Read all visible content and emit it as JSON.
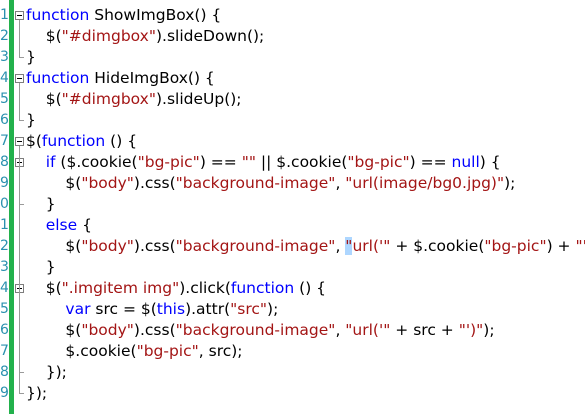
{
  "editor": {
    "line_numbers": [
      "1",
      "2",
      "3",
      "4",
      "5",
      "6",
      "7",
      "8",
      "9",
      "0",
      "1",
      "2",
      "3",
      "4",
      "5",
      "6",
      "7",
      "8",
      "9"
    ],
    "lines": [
      [
        {
          "t": "kw",
          "v": "function"
        },
        {
          "t": "pl",
          "v": " ShowImgBox() {"
        }
      ],
      [
        {
          "t": "pl",
          "v": "    $("
        },
        {
          "t": "str",
          "v": "\"#dimgbox\""
        },
        {
          "t": "pl",
          "v": ").slideDown();"
        }
      ],
      [
        {
          "t": "pl",
          "v": "}"
        }
      ],
      [
        {
          "t": "kw",
          "v": "function"
        },
        {
          "t": "pl",
          "v": " HideImgBox() {"
        }
      ],
      [
        {
          "t": "pl",
          "v": "    $("
        },
        {
          "t": "str",
          "v": "\"#dimgbox\""
        },
        {
          "t": "pl",
          "v": ").slideUp();"
        }
      ],
      [
        {
          "t": "pl",
          "v": "}"
        }
      ],
      [
        {
          "t": "pl",
          "v": "$("
        },
        {
          "t": "kw",
          "v": "function"
        },
        {
          "t": "pl",
          "v": " () {"
        }
      ],
      [
        {
          "t": "pl",
          "v": "    "
        },
        {
          "t": "kw",
          "v": "if"
        },
        {
          "t": "pl",
          "v": " ($.cookie("
        },
        {
          "t": "str",
          "v": "\"bg-pic\""
        },
        {
          "t": "pl",
          "v": ") == "
        },
        {
          "t": "str",
          "v": "\"\""
        },
        {
          "t": "pl",
          "v": " || $.cookie("
        },
        {
          "t": "str",
          "v": "\"bg-pic\""
        },
        {
          "t": "pl",
          "v": ") == "
        },
        {
          "t": "kw",
          "v": "null"
        },
        {
          "t": "pl",
          "v": ") {"
        }
      ],
      [
        {
          "t": "pl",
          "v": "        $("
        },
        {
          "t": "str",
          "v": "\"body\""
        },
        {
          "t": "pl",
          "v": ").css("
        },
        {
          "t": "str",
          "v": "\"background-image\""
        },
        {
          "t": "pl",
          "v": ", "
        },
        {
          "t": "str",
          "v": "\"url(image/bg0.jpg)\""
        },
        {
          "t": "pl",
          "v": ");"
        }
      ],
      [
        {
          "t": "pl",
          "v": "    }"
        }
      ],
      [
        {
          "t": "pl",
          "v": "    "
        },
        {
          "t": "kw",
          "v": "else"
        },
        {
          "t": "pl",
          "v": " {"
        }
      ],
      [
        {
          "t": "pl",
          "v": "        $("
        },
        {
          "t": "str",
          "v": "\"body\""
        },
        {
          "t": "pl",
          "v": ").css("
        },
        {
          "t": "str",
          "v": "\"background-image\""
        },
        {
          "t": "pl",
          "v": ", "
        },
        {
          "t": "sel",
          "v": "\""
        },
        {
          "t": "str",
          "v": "url('\""
        },
        {
          "t": "pl",
          "v": " + $.cookie("
        },
        {
          "t": "str",
          "v": "\"bg-pic\""
        },
        {
          "t": "pl",
          "v": ") + "
        },
        {
          "t": "str",
          "v": "\"')\""
        },
        {
          "t": "pl",
          "v": ");"
        }
      ],
      [
        {
          "t": "pl",
          "v": "    }"
        }
      ],
      [
        {
          "t": "pl",
          "v": "    $("
        },
        {
          "t": "str",
          "v": "\".imgitem img\""
        },
        {
          "t": "pl",
          "v": ").click("
        },
        {
          "t": "kw",
          "v": "function"
        },
        {
          "t": "pl",
          "v": " () {"
        }
      ],
      [
        {
          "t": "pl",
          "v": "        "
        },
        {
          "t": "kw",
          "v": "var"
        },
        {
          "t": "pl",
          "v": " src = $("
        },
        {
          "t": "kw",
          "v": "this"
        },
        {
          "t": "pl",
          "v": ").attr("
        },
        {
          "t": "str",
          "v": "\"src\""
        },
        {
          "t": "pl",
          "v": ");"
        }
      ],
      [
        {
          "t": "pl",
          "v": "        $("
        },
        {
          "t": "str",
          "v": "\"body\""
        },
        {
          "t": "pl",
          "v": ").css("
        },
        {
          "t": "str",
          "v": "\"background-image\""
        },
        {
          "t": "pl",
          "v": ", "
        },
        {
          "t": "str",
          "v": "\"url('\""
        },
        {
          "t": "pl",
          "v": " + src + "
        },
        {
          "t": "str",
          "v": "\"')\""
        },
        {
          "t": "pl",
          "v": ");"
        }
      ],
      [
        {
          "t": "pl",
          "v": "        $.cookie("
        },
        {
          "t": "str",
          "v": "\"bg-pic\""
        },
        {
          "t": "pl",
          "v": ", src);"
        }
      ],
      [
        {
          "t": "pl",
          "v": "    });"
        }
      ],
      [
        {
          "t": "pl",
          "v": "});"
        }
      ]
    ],
    "colors": {
      "keyword": "#0000ff",
      "string": "#a31515",
      "plain": "#000000",
      "gutter_bar": "#22b14c",
      "line_number": "#2b91af"
    }
  }
}
